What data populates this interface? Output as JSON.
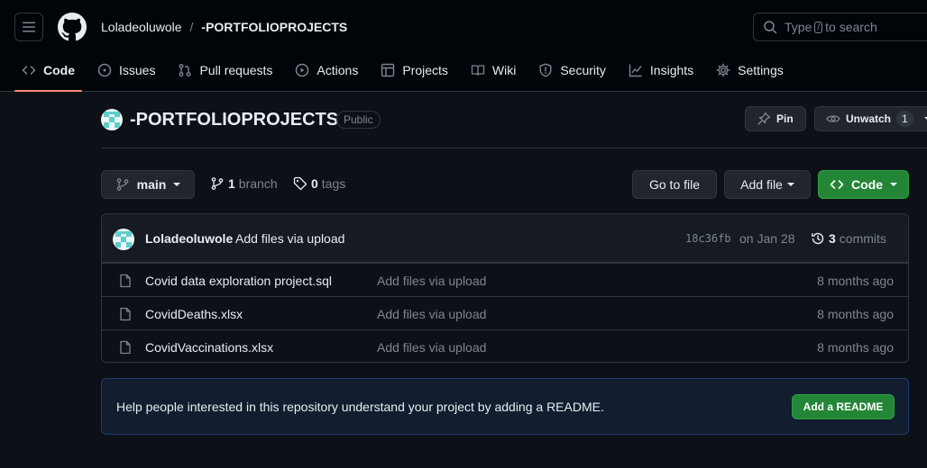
{
  "header": {
    "owner": "Loladeoluwole",
    "separator": "/",
    "repo": "-PORTFOLIOPROJECTS",
    "search_placeholder_before": "Type",
    "search_key": "/",
    "search_placeholder_after": "to search"
  },
  "tabs": [
    {
      "label": "Code",
      "icon": "code-icon",
      "active": true
    },
    {
      "label": "Issues",
      "icon": "issue-icon"
    },
    {
      "label": "Pull requests",
      "icon": "pull-request-icon"
    },
    {
      "label": "Actions",
      "icon": "play-icon"
    },
    {
      "label": "Projects",
      "icon": "table-icon"
    },
    {
      "label": "Wiki",
      "icon": "book-icon"
    },
    {
      "label": "Security",
      "icon": "shield-icon"
    },
    {
      "label": "Insights",
      "icon": "graph-icon"
    },
    {
      "label": "Settings",
      "icon": "gear-icon"
    }
  ],
  "repo_head": {
    "name": "-PORTFOLIOPROJECTS",
    "visibility": "Public",
    "pin_label": "Pin",
    "watch_label": "Unwatch",
    "watch_count": "1"
  },
  "toolbar": {
    "branch": "main",
    "branch_count": "1",
    "branch_label": "branch",
    "tag_count": "0",
    "tag_label": "tags",
    "goto_label": "Go to file",
    "addfile_label": "Add file",
    "code_label": "Code"
  },
  "commit": {
    "author": "Loladeoluwole",
    "message": "Add files via upload",
    "sha": "18c36fb",
    "date": "on Jan 28",
    "count": "3",
    "count_label": "commits"
  },
  "files": [
    {
      "name": "Covid data exploration project.sql",
      "message": "Add files via upload",
      "age": "8 months ago"
    },
    {
      "name": "CovidDeaths.xlsx",
      "message": "Add files via upload",
      "age": "8 months ago"
    },
    {
      "name": "CovidVaccinations.xlsx",
      "message": "Add files via upload",
      "age": "8 months ago"
    }
  ],
  "readme": {
    "text": "Help people interested in this repository understand your project by adding a README.",
    "button": "Add a README"
  },
  "colors": {
    "background": "#0d1117",
    "accent_green": "#238636",
    "active_tab_underline": "#fd8c73"
  }
}
